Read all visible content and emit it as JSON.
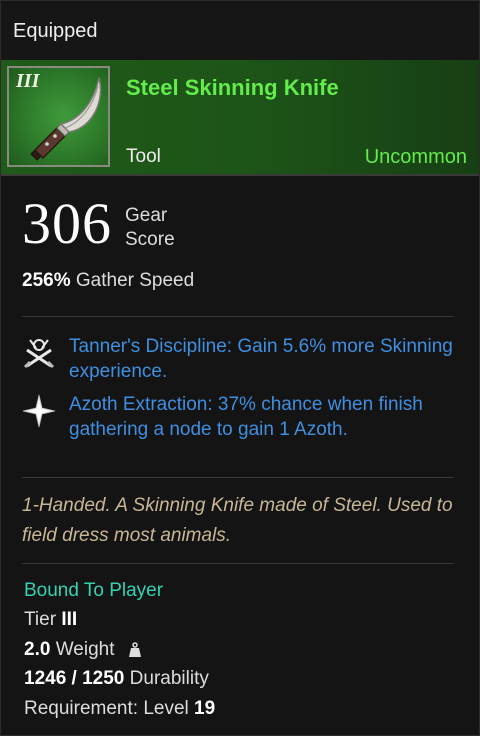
{
  "equipped_label": "Equipped",
  "item": {
    "tier_roman": "III",
    "name": "Steel Skinning Knife",
    "type": "Tool",
    "rarity": "Uncommon",
    "rarity_color": "#63ec4c"
  },
  "gear_score": {
    "value": "306",
    "label_line1": "Gear",
    "label_line2": "Score"
  },
  "stat": {
    "value": "256%",
    "label": "Gather Speed"
  },
  "perks": [
    {
      "icon": "tanner-discipline-icon",
      "name": "Tanner's Discipline:",
      "description": "Gain 5.6% more Skinning experience."
    },
    {
      "icon": "azoth-star-icon",
      "name": "Azoth Extraction:",
      "description": "37% chance when finish gathering a node to gain 1 Azoth."
    }
  ],
  "flavor_text": "1-Handed. A Skinning Knife made of Steel. Used to field dress most animals.",
  "bound": "Bound To Player",
  "tier": {
    "label": "Tier",
    "value": "III"
  },
  "weight": {
    "value": "2.0",
    "label": "Weight"
  },
  "durability": {
    "value": "1246 / 1250",
    "label": "Durability"
  },
  "requirement": {
    "label": "Requirement:",
    "level_label": "Level",
    "level_value": "19"
  },
  "colors": {
    "perk_blue": "#3f8fe1",
    "flavor_tan": "#c8b797",
    "bound_teal": "#33d3b2",
    "header_green": "#1f5b19"
  }
}
